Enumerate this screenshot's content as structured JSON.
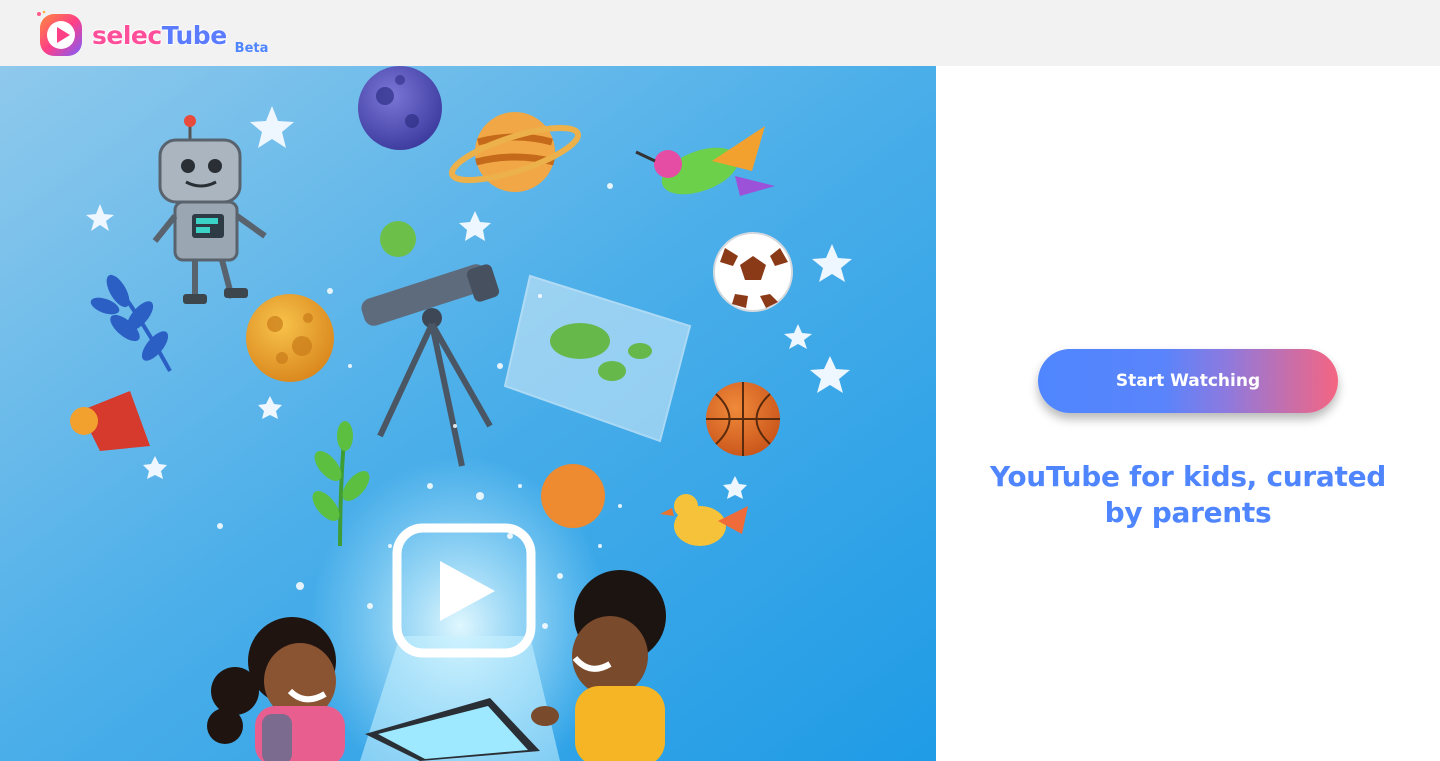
{
  "header": {
    "brand_prefix": "selec",
    "brand_suffix": "Tube",
    "badge": "Beta"
  },
  "hero": {
    "icons": [
      "robot-icon",
      "planet-icon",
      "telescope-icon",
      "bird-icon",
      "soccer-ball-icon",
      "basketball-icon",
      "map-icon",
      "play-button-icon",
      "star-icon",
      "leaf-icon"
    ]
  },
  "main": {
    "cta_label": "Start Watching",
    "tagline": "YouTube for kids, curated by parents"
  },
  "colors": {
    "accent_blue": "#4f86ff",
    "accent_pink": "#f56582",
    "header_bg": "#f2f2f2",
    "hero_bg": "#2da0e6"
  }
}
